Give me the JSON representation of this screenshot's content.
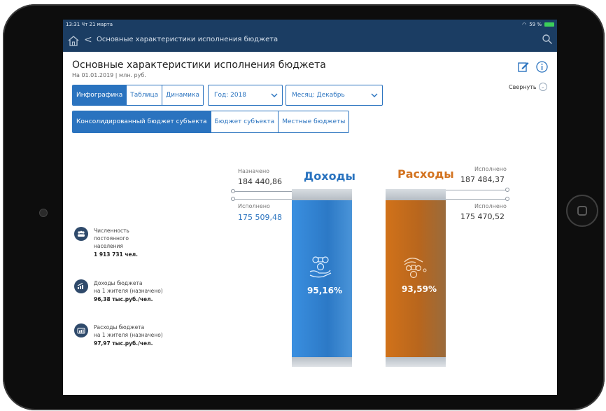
{
  "status_bar": {
    "time": "13:31  Чт 21 марта",
    "battery": "59 %"
  },
  "nav": {
    "title": "Основные характеристики исполнения бюджета"
  },
  "page": {
    "title": "Основные характеристики исполнения бюджета",
    "subtitle": "На 01.01.2019 | млн. руб.",
    "collapse_label": "Свернуть"
  },
  "view_tabs": [
    "Инфографика",
    "Таблица",
    "Динамика"
  ],
  "filters": {
    "year": "Год: 2018",
    "month": "Месяц: Декабрь"
  },
  "budget_tabs": [
    "Консолидированный бюджет субъекта",
    "Бюджет субъекта",
    "Местные бюджеты"
  ],
  "income": {
    "title": "Доходы",
    "assigned_label": "Назначено",
    "assigned_value": "184 440,86",
    "executed_label": "Исполнено",
    "executed_value": "175 509,48",
    "percent": "95,16%",
    "percent_value": 95.16,
    "icon": "money-hand-icon"
  },
  "expense": {
    "title": "Расходы",
    "assigned_label": "Исполнено",
    "assigned_value": "187 484,37",
    "executed_label": "Исполнено",
    "executed_value": "175 470,52",
    "percent": "93,59%",
    "percent_value": 93.59,
    "icon": "money-give-icon"
  },
  "stats": [
    {
      "icon": "people-icon",
      "line1": "Численность",
      "line2": "постоянного",
      "line3": "населения",
      "value": "1 913 731 чел."
    },
    {
      "icon": "growth-chart-icon",
      "line1": "Доходы бюджета",
      "line2": "на 1 жителя (назначено)",
      "line3": "",
      "value": "96,38 тыс.руб./чел."
    },
    {
      "icon": "wallet-icon",
      "line1": "Расходы бюджета",
      "line2": "на 1 жителя (назначено)",
      "line3": "",
      "value": "97,97 тыс.руб./чел."
    }
  ],
  "colors": {
    "nav_bg": "#1b3d63",
    "accent": "#2a73bf",
    "income": "#2c79c6",
    "expense": "#c86d1c"
  }
}
